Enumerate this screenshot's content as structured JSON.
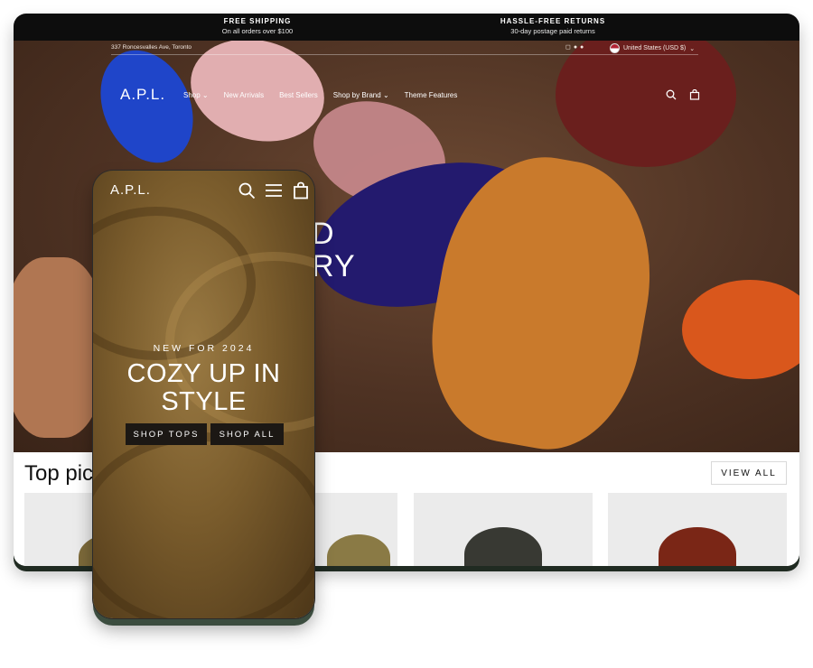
{
  "announcement": {
    "left": {
      "title": "FREE SHIPPING",
      "subtitle": "On all orders over $100"
    },
    "right": {
      "title": "HASSLE-FREE RETURNS",
      "subtitle": "30-day postage paid returns"
    }
  },
  "utility": {
    "address": "337 Roncesvalles Ave, Toronto",
    "social_icons": [
      "instagram-icon",
      "facebook-icon",
      "pinterest-icon"
    ],
    "country_label": "United States (USD $)"
  },
  "nav": {
    "logo": "A.P.L.",
    "items": [
      {
        "label": "Shop",
        "dropdown": true
      },
      {
        "label": "New Arrivals",
        "dropdown": false
      },
      {
        "label": "Best Sellers",
        "dropdown": false
      },
      {
        "label": "Shop by Brand",
        "dropdown": true
      },
      {
        "label": "Theme Features",
        "dropdown": false
      }
    ],
    "icons": [
      "search-icon",
      "cart-icon"
    ]
  },
  "hero": {
    "line1": "D",
    "line2": "RY"
  },
  "products": {
    "heading": "Top pic",
    "view_all": "VIEW ALL"
  },
  "mobile": {
    "logo": "A.P.L.",
    "icons": [
      "search-icon",
      "menu-icon",
      "cart-icon"
    ],
    "eyebrow": "NEW FOR 2024",
    "title_line1": "COZY UP IN",
    "title_line2": "STYLE",
    "btn_tops": "SHOP TOPS",
    "btn_all": "SHOP ALL"
  },
  "colors": {
    "announcement_bg": "#0d0d0d",
    "button_bg": "#1c1814",
    "card_bg": "#ebebeb"
  }
}
